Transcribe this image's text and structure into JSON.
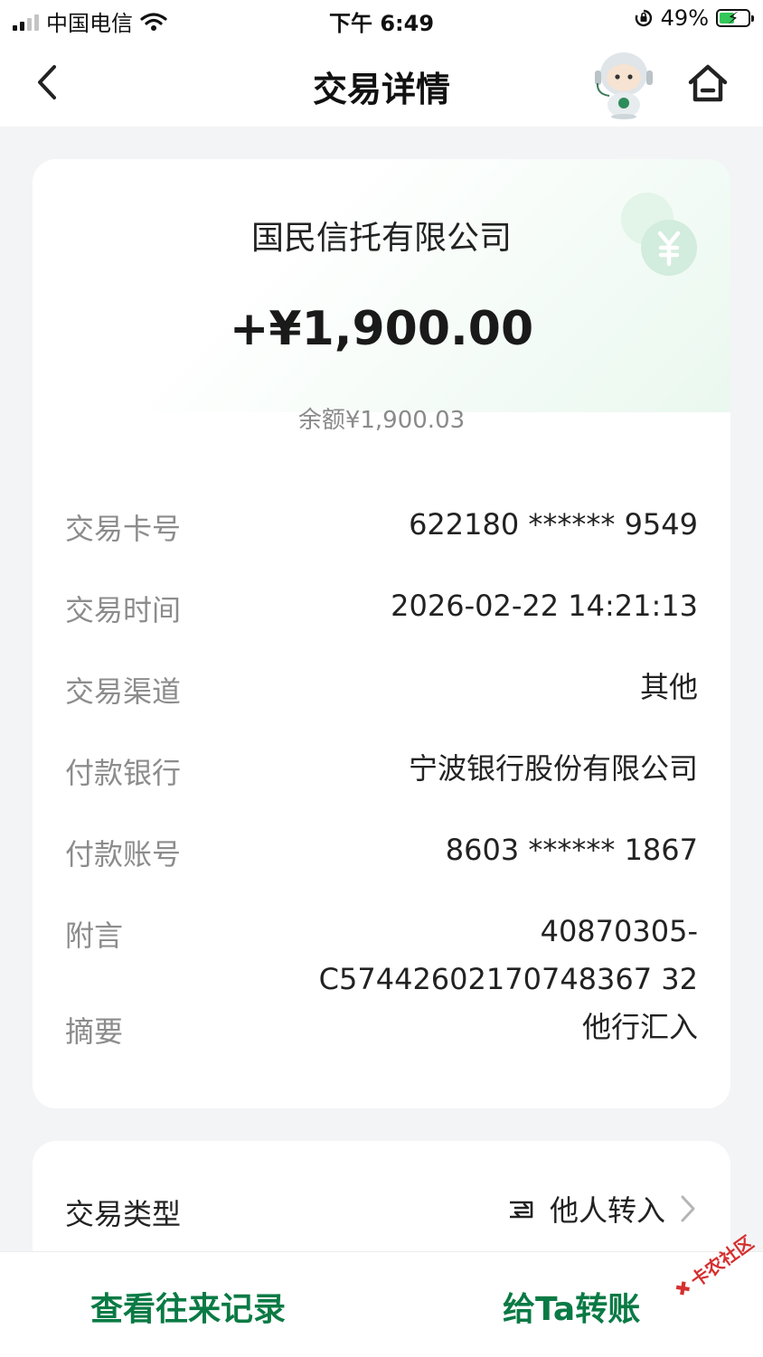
{
  "status_bar": {
    "carrier": "中国电信",
    "time": "下午 6:49",
    "battery": "49%",
    "battery_level": 0.49
  },
  "nav": {
    "title": "交易详情",
    "back_icon": "chevron-left-icon",
    "assistant_icon": "robot-assistant-icon",
    "home_icon": "home-icon"
  },
  "summary": {
    "payer": "国民信托有限公司",
    "amount": "+¥1,900.00",
    "balance": "余额¥1,900.03"
  },
  "details": [
    {
      "label": "交易卡号",
      "value": "622180 ****** 9549"
    },
    {
      "label": "交易时间",
      "value": "2026-02-22 14:21:13"
    },
    {
      "label": "交易渠道",
      "value": "其他"
    },
    {
      "label": "付款银行",
      "value": "宁波银行股份有限公司"
    },
    {
      "label": "付款账号",
      "value": "8603 ****** 1867"
    },
    {
      "label": "附言",
      "value_line1": "40870305-",
      "value_line2": "C57442602170748367 32"
    },
    {
      "label": "摘要",
      "value": "他行汇入"
    }
  ],
  "transaction_type": {
    "label": "交易类型",
    "value": "他人转入"
  },
  "actions": {
    "history": "查看往来记录",
    "transfer": "给Ta转账"
  },
  "watermark": "卡农社区",
  "colors": {
    "accent_green": "#0a7a44",
    "light_green": "#eaf8ef",
    "label_gray": "#8c8c8c"
  }
}
